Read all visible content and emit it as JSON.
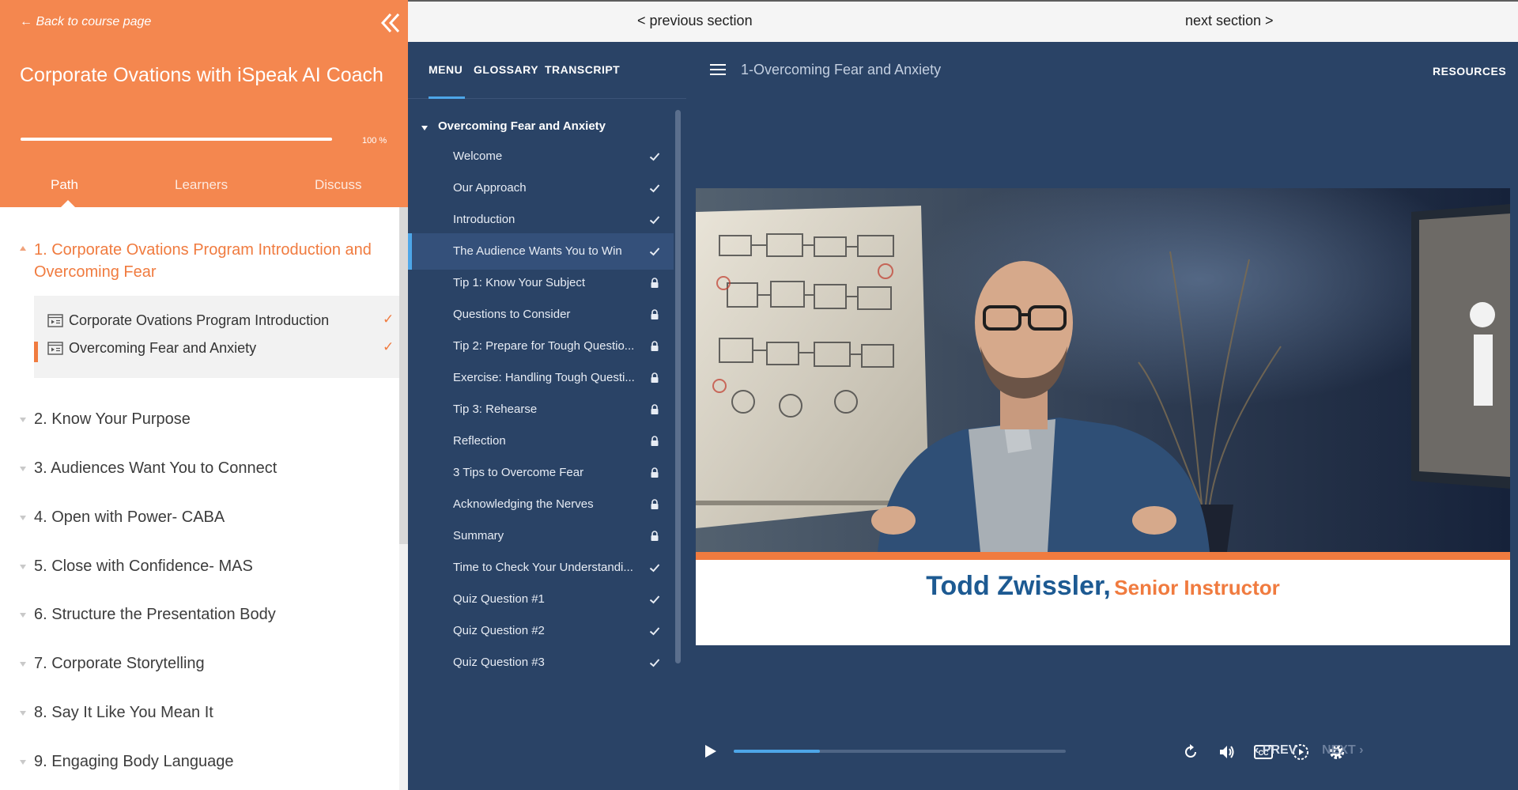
{
  "left_panel": {
    "back_link": "← Back to course page",
    "course_title": "Corporate Ovations with iSpeak AI Coach",
    "progress_text": "100 %",
    "progress_fraction": 1.0,
    "tabs": [
      {
        "label": "Path",
        "active": true
      },
      {
        "label": "Learners",
        "active": false
      },
      {
        "label": "Discuss",
        "active": false
      }
    ],
    "modules": [
      {
        "label": "1. Corporate Ovations Program Introduction and Overcoming Fear",
        "expanded": true
      },
      {
        "label": "2. Know Your Purpose"
      },
      {
        "label": "3. Audiences Want You to Connect"
      },
      {
        "label": "4. Open with Power- CABA"
      },
      {
        "label": "5. Close with Confidence- MAS"
      },
      {
        "label": "6. Structure the Presentation Body"
      },
      {
        "label": "7. Corporate Storytelling"
      },
      {
        "label": "8. Say It Like You Mean It"
      },
      {
        "label": "9. Engaging Body Language"
      }
    ],
    "lessons": [
      {
        "label": "Corporate Ovations Program Introduction",
        "check": "✓"
      },
      {
        "label": "Overcoming Fear and Anxiety",
        "check": "✓",
        "active": true
      }
    ]
  },
  "topbar": {
    "previous_section": "< previous section",
    "next_section": "next section >"
  },
  "menu_panel": {
    "tabs": [
      "MENU",
      "GLOSSARY",
      "TRANSCRIPT"
    ],
    "section_title": "Overcoming Fear and Anxiety",
    "items": [
      {
        "label": "Welcome",
        "status": "check"
      },
      {
        "label": "Our Approach",
        "status": "check"
      },
      {
        "label": "Introduction",
        "status": "check"
      },
      {
        "label": "The Audience Wants You to Win",
        "status": "check",
        "active": true
      },
      {
        "label": "Tip 1: Know Your Subject",
        "status": "lock"
      },
      {
        "label": "Questions to Consider",
        "status": "lock"
      },
      {
        "label": "Tip 2: Prepare for Tough Questio...",
        "status": "lock"
      },
      {
        "label": "Exercise: Handling Tough Questi...",
        "status": "lock"
      },
      {
        "label": "Tip 3: Rehearse",
        "status": "lock"
      },
      {
        "label": "Reflection",
        "status": "lock"
      },
      {
        "label": "3 Tips to Overcome Fear",
        "status": "lock"
      },
      {
        "label": "Acknowledging the Nerves",
        "status": "lock"
      },
      {
        "label": "Summary",
        "status": "lock"
      },
      {
        "label": "Time to Check Your Understandi...",
        "status": "check"
      },
      {
        "label": "Quiz Question #1",
        "status": "check"
      },
      {
        "label": "Quiz Question #2",
        "status": "check"
      },
      {
        "label": "Quiz Question #3",
        "status": "check"
      }
    ]
  },
  "player": {
    "lesson_heading": "1-Overcoming Fear and Anxiety",
    "resources": "RESOURCES",
    "speaker_name": "Todd Zwissler,",
    "speaker_role": "Senior Instructor",
    "seek_progress": 0.26,
    "prev_label": "PREV",
    "next_label": "NEXT"
  },
  "colors": {
    "accent_orange": "#f4874f",
    "navy": "#2a4366",
    "active_blue": "#4da6e8",
    "name_blue": "#1d5a92"
  },
  "icons": [
    "collapse-icon",
    "caret-icon",
    "lesson-page-icon",
    "check-icon",
    "lock-icon",
    "hamburger-icon",
    "play-icon",
    "replay-icon",
    "volume-icon",
    "captions-icon",
    "playback-speed-icon",
    "settings-icon",
    "chevron-left-icon",
    "chevron-right-icon"
  ]
}
